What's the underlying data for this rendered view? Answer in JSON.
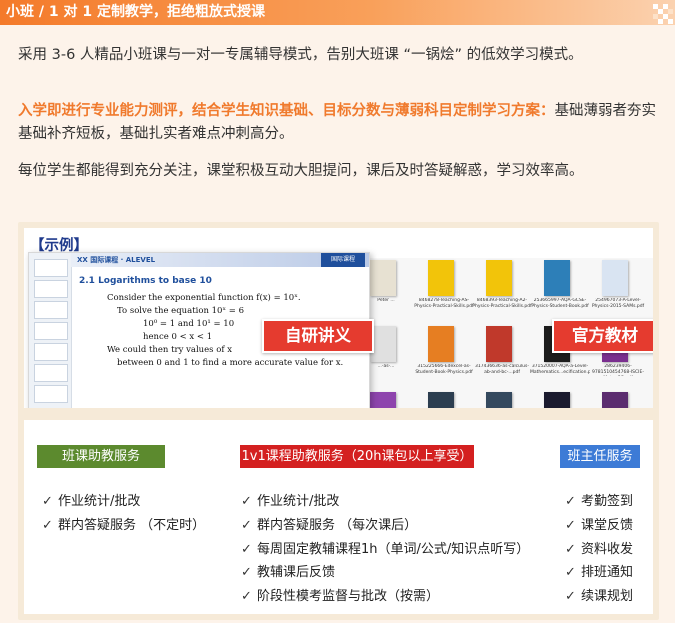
{
  "header": {
    "title": "小班 / 1 对 1 定制教学，拒绝粗放式授课"
  },
  "paragraphs": {
    "p1": "采用 3-6 人精品小班课与一对一专属辅导模式，告别大班课 “一锅烩” 的低效学习模式。",
    "p2_highlight": "入学即进行专业能力测评，结合学生知识基础、目标分数与薄弱科目定制学习方案：",
    "p2_rest": "基础薄弱者夯实基础补齐短板，基础扎实者难点冲刺高分。",
    "p3": "每位学生都能得到充分关注，课堂积极互动大胆提问，课后及时答疑解惑，学习效率高。"
  },
  "example": {
    "title": "【示例】",
    "doc": {
      "logo": "XX 国际课程 · ALEVEL",
      "banner": "国际课程",
      "heading": "2.1  Logarithms to base 10",
      "lines": [
        "Consider the exponential function  f(x) = 10ˣ.",
        "To solve the equation  10ˣ = 6",
        "10⁰ = 1        and        10¹ = 10",
        "hence  0 < x < 1",
        "We could then try values of  x",
        "between 0 and 1 to find a more accurate value for  x."
      ]
    },
    "files": [
      {
        "name": "Peter ...",
        "color": "#e7e1d2"
      },
      {
        "name": "8468278-Teaching-AS-Physics-Practical-Skills.pdf",
        "color": "#f2c40a"
      },
      {
        "name": "8468393-Teaching-A2-Physics-Practical-Skills.pdf",
        "color": "#f2c40a"
      },
      {
        "name": "253665997-AQA-GCSE-Physics-Student-Book.pdf",
        "color": "#2d7fb8"
      },
      {
        "name": "254967073-A-Level-Physics-2015-SAMs.pdf",
        "color": "#d9e4f2"
      },
      {
        "name": "...-as-...",
        "color": "#e0e0e0"
      },
      {
        "name": "315225666-Edexcel-as-Student-Book-Physics.pdf",
        "color": "#e67e22"
      },
      {
        "name": "317436636-as-calculus-ab-and-bc-...pdf",
        "color": "#c0392b"
      },
      {
        "name": "371520007-AQA-a-Level-Mathematics...ecification.pdf",
        "color": "#1c1c1c"
      },
      {
        "name": "286239406-9781510454768-ISCIE-Mat...-SG.pdf",
        "color": "#7a2f8f"
      },
      {
        "name": "",
        "color": "#8e44ad"
      },
      {
        "name": "",
        "color": "#2c3e50"
      },
      {
        "name": "",
        "color": "#34495e"
      },
      {
        "name": "",
        "color": "#1a1a2e"
      },
      {
        "name": "",
        "color": "#5b2c6f"
      }
    ],
    "label_self": "自研讲义",
    "label_official": "官方教材"
  },
  "services": {
    "class_head": "班课助教服务",
    "class_items": [
      "作业统计/批改",
      "群内答疑服务 （不定时）"
    ],
    "oneonone_head": "1v1课程助教服务（20h课包以上享受）",
    "oneonone_items": [
      "作业统计/批改",
      "群内答疑服务 （每次课后）",
      "每周固定教辅课程1h（单词/公式/知识点听写）",
      "教辅课后反馈",
      "阶段性模考监督与批改（按需）"
    ],
    "headteacher_head": "班主任服务",
    "headteacher_items": [
      "考勤签到",
      "课堂反馈",
      "资料收发",
      "排班通知",
      "续课规划"
    ],
    "check": "✓"
  },
  "colors": {
    "accent_orange": "#f07a2d",
    "label_red": "#e53b2f",
    "class_green": "#5c8a2e",
    "oneonone_red": "#d42020",
    "head_blue": "#3d7bd6"
  }
}
